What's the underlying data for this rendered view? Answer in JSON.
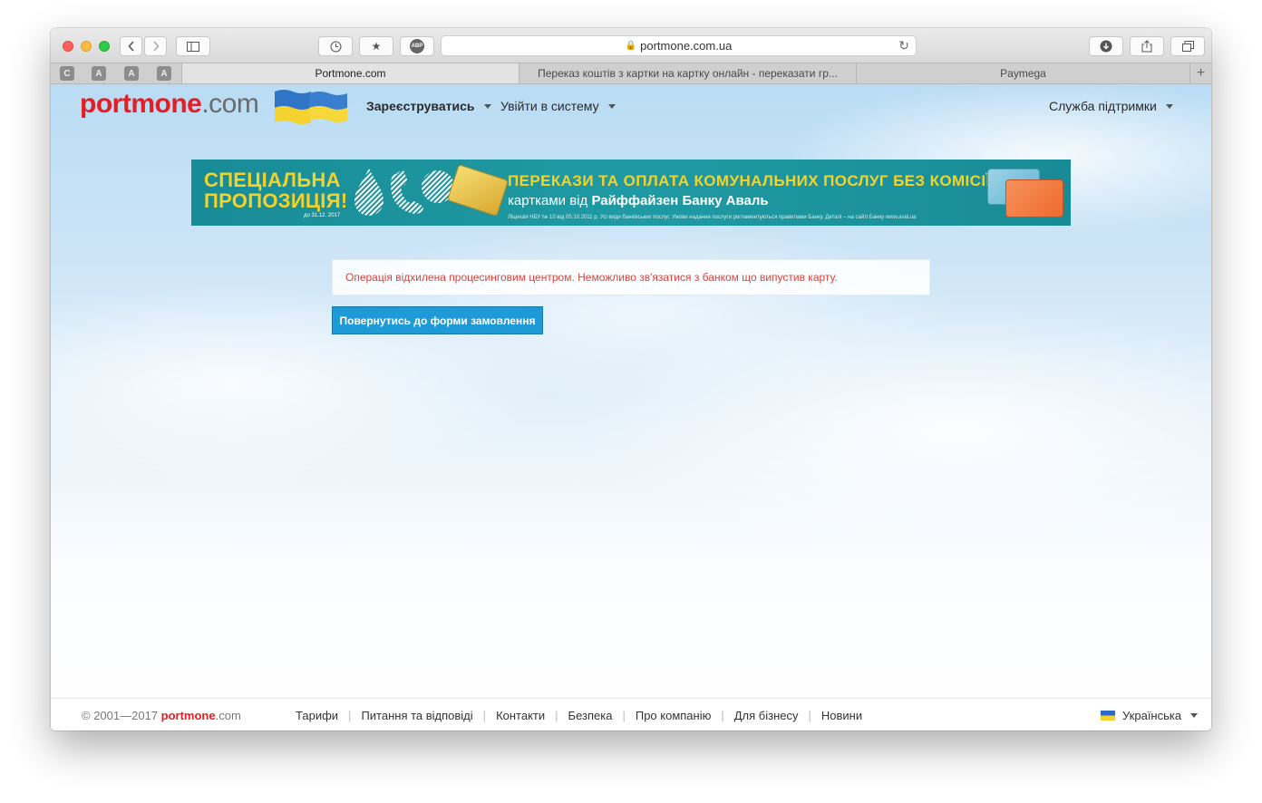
{
  "browser": {
    "url": "portmone.com.ua",
    "toolbar_icons": [
      "back-icon",
      "forward-icon",
      "sidebar-icon",
      "history-icon",
      "bookmark-star-icon",
      "adblock-icon",
      "download-icon",
      "share-icon",
      "tabs-icon"
    ],
    "adblock_label": "ABP",
    "pinned_tabs": [
      "C",
      "A",
      "A",
      "A"
    ],
    "tabs": [
      {
        "label": "Portmone.com",
        "active": true
      },
      {
        "label": "Переказ коштів з картки на картку онлайн - переказати гр...",
        "active": false
      },
      {
        "label": "Paymega",
        "active": false
      }
    ],
    "new_tab": "+"
  },
  "header": {
    "logo_part1": "portmone",
    "logo_part2": ".com",
    "nav": {
      "register": "Зареєструватись",
      "login": "Увійти в систему",
      "support": "Служба підтримки"
    }
  },
  "banner": {
    "left_line1": "СПЕЦІАЛЬНА",
    "left_line2": "ПРОПОЗИЦІЯ!",
    "date": "до 31.12. 2017",
    "title": "ПЕРЕКАЗИ ТА ОПЛАТА КОМУНАЛЬНИХ ПОСЛУГ БЕЗ КОМІСІЇ",
    "sub_prefix": "картками від ",
    "sub_bank": "Райффайзен Банку Аваль",
    "fine_print": "Ліцензія НБУ № 10 від 05.10.2011 р. Усі види банківських послуг. Умови надання послуги регламентуються правилами Банку. Деталі – на сайті Банку www.aval.ua"
  },
  "message": {
    "error": "Операція відхилена процесинговим центром. Неможливо зв'язатися з банком що випустив карту.",
    "back_button": "Повернутись до форми замовлення"
  },
  "footer": {
    "copyright": "© 2001—2017 ",
    "logo_part1": "portmone",
    "logo_part2": ".com",
    "links": [
      "Тарифи",
      "Питання та відповіді",
      "Контакти",
      "Безпека",
      "Про компанію",
      "Для бізнесу",
      "Новини"
    ],
    "separator": "|",
    "language": "Українська"
  },
  "colors": {
    "brand_red": "#e31e24",
    "error_text": "#d9443a",
    "button_blue": "#1e9ad6",
    "banner_teal": "#1f9aa4",
    "banner_yellow": "#f3d32a"
  }
}
